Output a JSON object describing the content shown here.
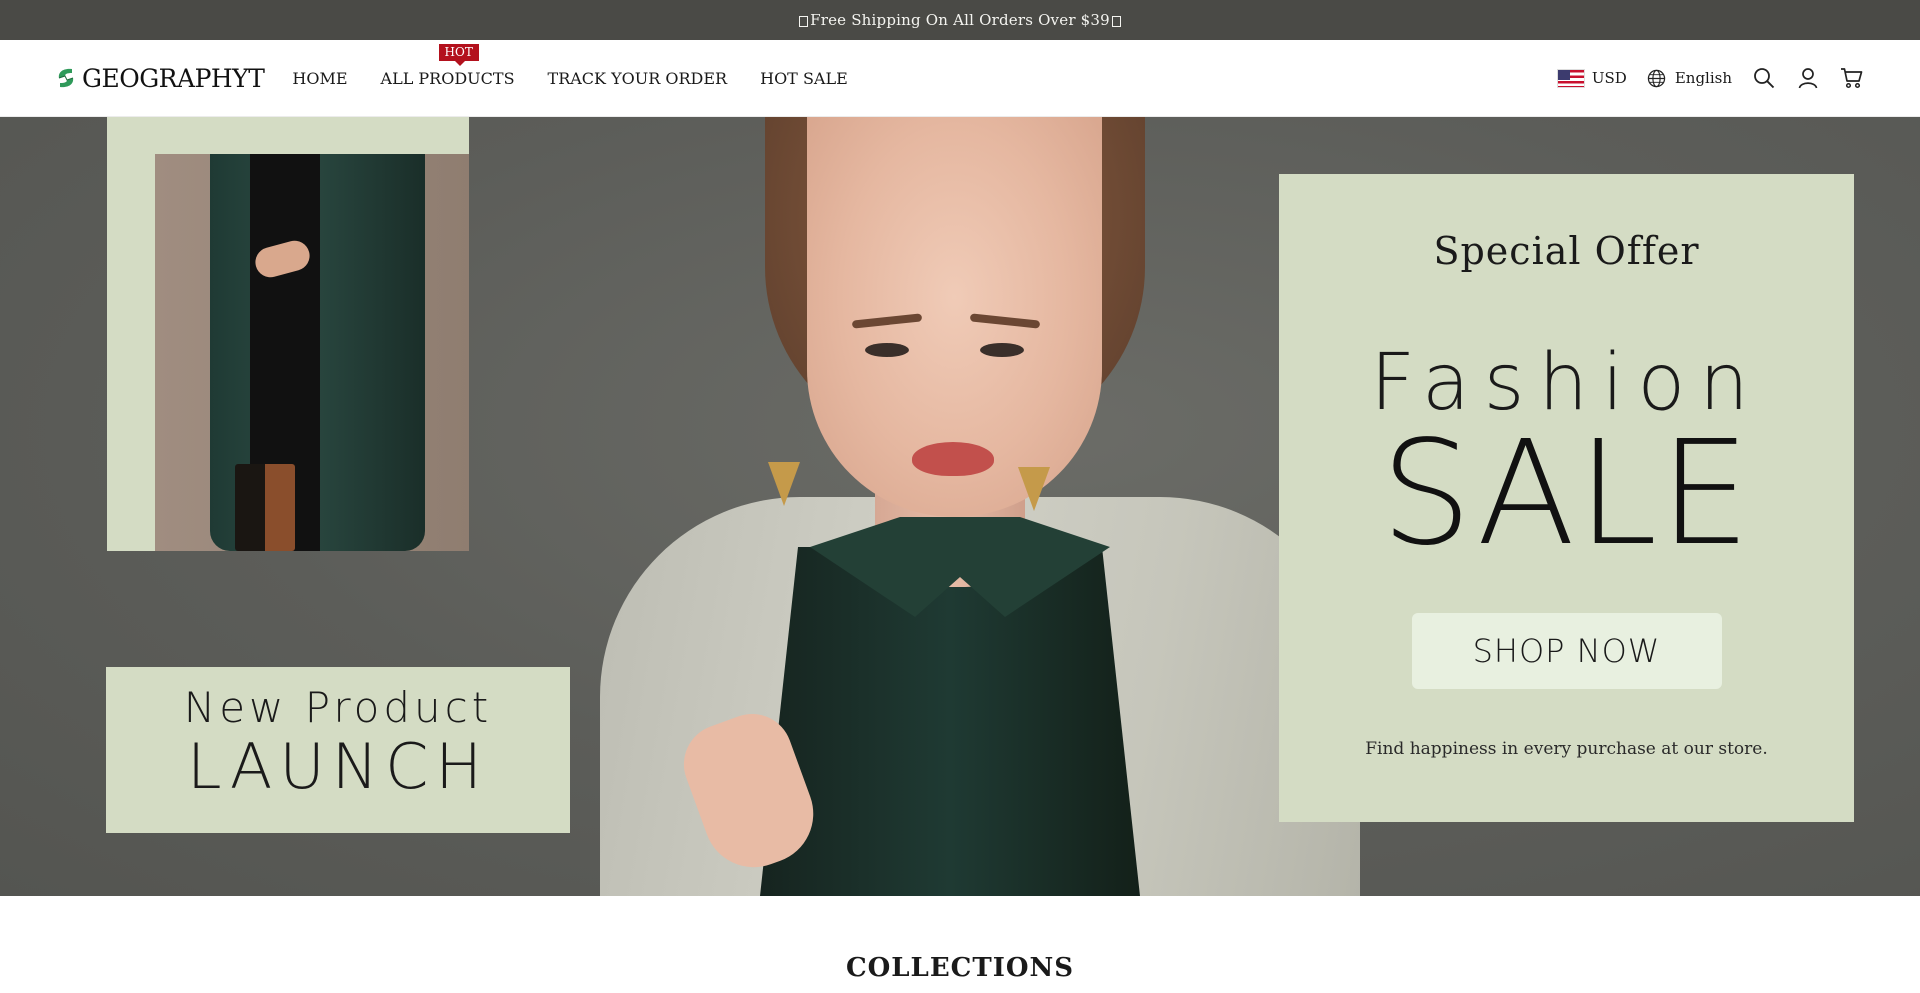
{
  "announcement": {
    "text": "Free Shipping On All Orders Over $39"
  },
  "header": {
    "logo_text": "GEOGRAPHYT",
    "nav": [
      {
        "label": "HOME"
      },
      {
        "label": "ALL PRODUCTS",
        "badge": "HOT"
      },
      {
        "label": "TRACK YOUR ORDER"
      },
      {
        "label": "HOT SALE"
      }
    ],
    "currency": "USD",
    "language": "English"
  },
  "hero": {
    "launch_sub": "New Product",
    "launch_main": "LAUNCH",
    "offer_title": "Special Offer",
    "offer_fashion": "Fashion",
    "offer_sale": "SALE",
    "shop_button": "SHOP NOW",
    "tagline": "Find happiness in every purchase at our store."
  },
  "sections": {
    "collections_title": "COLLECTIONS"
  },
  "colors": {
    "announcement_bg": "#4a4a46",
    "hero_bg": "#5d5e5a",
    "panel_sage": "#d4dcc4",
    "badge_red": "#b3111d",
    "logo_green": "#2f9a5a"
  },
  "icons": [
    "flag-us-icon",
    "globe-icon",
    "search-icon",
    "account-icon",
    "cart-icon",
    "logo-icon"
  ]
}
